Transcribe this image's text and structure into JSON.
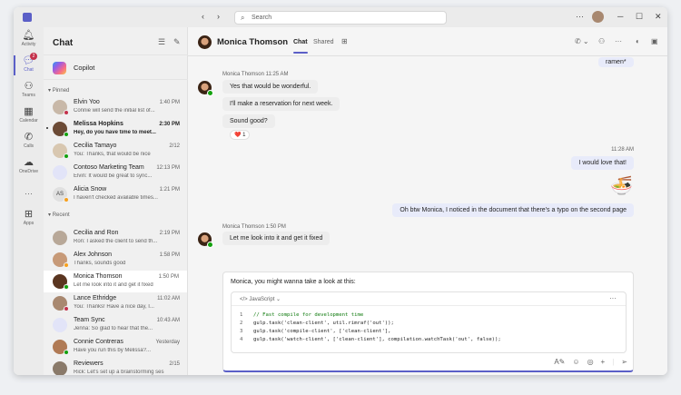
{
  "titlebar": {
    "search_placeholder": "Search",
    "more": "···",
    "min": "─",
    "max": "☐",
    "close": "✕",
    "back": "‹",
    "forward": "›"
  },
  "rail": [
    {
      "label": "Activity",
      "icon": "bell-icon",
      "glyph": "🔔︎"
    },
    {
      "label": "Chat",
      "icon": "chat-icon",
      "glyph": "💬︎",
      "badge": "2"
    },
    {
      "label": "Teams",
      "icon": "teams-icon",
      "glyph": "⚇"
    },
    {
      "label": "Calendar",
      "icon": "calendar-icon",
      "glyph": "▦"
    },
    {
      "label": "Calls",
      "icon": "phone-icon",
      "glyph": "✆"
    },
    {
      "label": "OneDrive",
      "icon": "cloud-icon",
      "glyph": "☁"
    },
    {
      "label": "···"
    },
    {
      "label": "Apps",
      "icon": "apps-icon",
      "glyph": "⊞"
    }
  ],
  "chatlist": {
    "title": "Chat",
    "copilot": "Copilot",
    "pinned": "Pinned",
    "recent": "Recent",
    "pinned_items": [
      {
        "name": "Elvin Yoo",
        "preview": "Connie will send the initial list of...",
        "time": "1:40 PM",
        "status": "#c4314b",
        "avatar_color": "#c8b8a8"
      },
      {
        "name": "Melissa Hopkins",
        "preview": "Hey, do you have time to meet...",
        "time": "2:30 PM",
        "status": "#13a10e",
        "avatar_color": "#6b4a35",
        "bold": true
      },
      {
        "name": "Cecilia Tamayo",
        "preview": "You: Thanks, that would be nice",
        "time": "2/12",
        "status": "#13a10e",
        "avatar_color": "#d8c7b0"
      },
      {
        "name": "Contoso Marketing Team",
        "preview": "Elvin: It would be great to sync...",
        "time": "12:13 PM",
        "avatar_color": "#e2e4f8"
      },
      {
        "name": "Alicia Snow",
        "preview": "I haven't checked available times...",
        "time": "1:21 PM",
        "status": "#f8a01c",
        "avatar_color": "#e0e0e0",
        "initials": "AS"
      }
    ],
    "recent_items": [
      {
        "name": "Cecilia and Ron",
        "preview": "Ron: I asked the client to send th...",
        "time": "2:19 PM",
        "avatar_color": "#b8a898"
      },
      {
        "name": "Alex Johnson",
        "preview": "Thanks, sounds good",
        "time": "1:58 PM",
        "status": "#f8a01c",
        "avatar_color": "#c79a78"
      },
      {
        "name": "Monica Thomson",
        "preview": "Let me look into it and get it fixed",
        "time": "1:50 PM",
        "status": "#13a10e",
        "avatar_color": "#5a3520"
      },
      {
        "name": "Lance Ethridge",
        "preview": "You: Thanks! Have a nice day, I...",
        "time": "11:02 AM",
        "status": "#c4314b",
        "avatar_color": "#a88870"
      },
      {
        "name": "Team Sync",
        "preview": "Jenna: So glad to hear that the...",
        "time": "10:43 AM",
        "avatar_color": "#e2e4f8"
      },
      {
        "name": "Connie Contreras",
        "preview": "Have you run this by Melissa?...",
        "time": "Yesterday",
        "status": "#13a10e",
        "avatar_color": "#b07a55"
      },
      {
        "name": "Reviewers",
        "preview": "Rick: Let's set up a brainstorming ses...",
        "time": "2/15",
        "avatar_color": "#8a7a6a"
      }
    ]
  },
  "chat": {
    "title": "Monica Thomson",
    "tabs": [
      "Chat",
      "Shared"
    ],
    "messages": {
      "ramen": "ramen*",
      "meta1": "Monica Thomson   11:25 AM",
      "m1": "Yes that would be wonderful.",
      "m2": "I'll make a reservation for next week.",
      "m3": "Sound good?",
      "reaction": "❤️ 1",
      "time2": "11:28 AM",
      "m4": "I would love that!",
      "emoji": "🍜",
      "m5": "Oh btw Monica, I noticed in the document that there's a typo on the second page",
      "meta3": "Monica Thomson   1:50 PM",
      "m6": "Let me look into it and get it fixed"
    },
    "compose": {
      "text": "Monica, you might wanna take a look at this:",
      "language": "JavaScript",
      "more": "···",
      "code": [
        {
          "n": "1",
          "t": "// Fast compile for development time"
        },
        {
          "n": "2",
          "t": "gulp.task('clean-client', util.rimraf('out'));"
        },
        {
          "n": "3",
          "t": "gulp.task('compile-client', ['clean-client'],"
        },
        {
          "n": "4",
          "t": "gulp.task('watch-client', ['clean-client'], compilation.watchTask('out', false));"
        }
      ]
    }
  }
}
